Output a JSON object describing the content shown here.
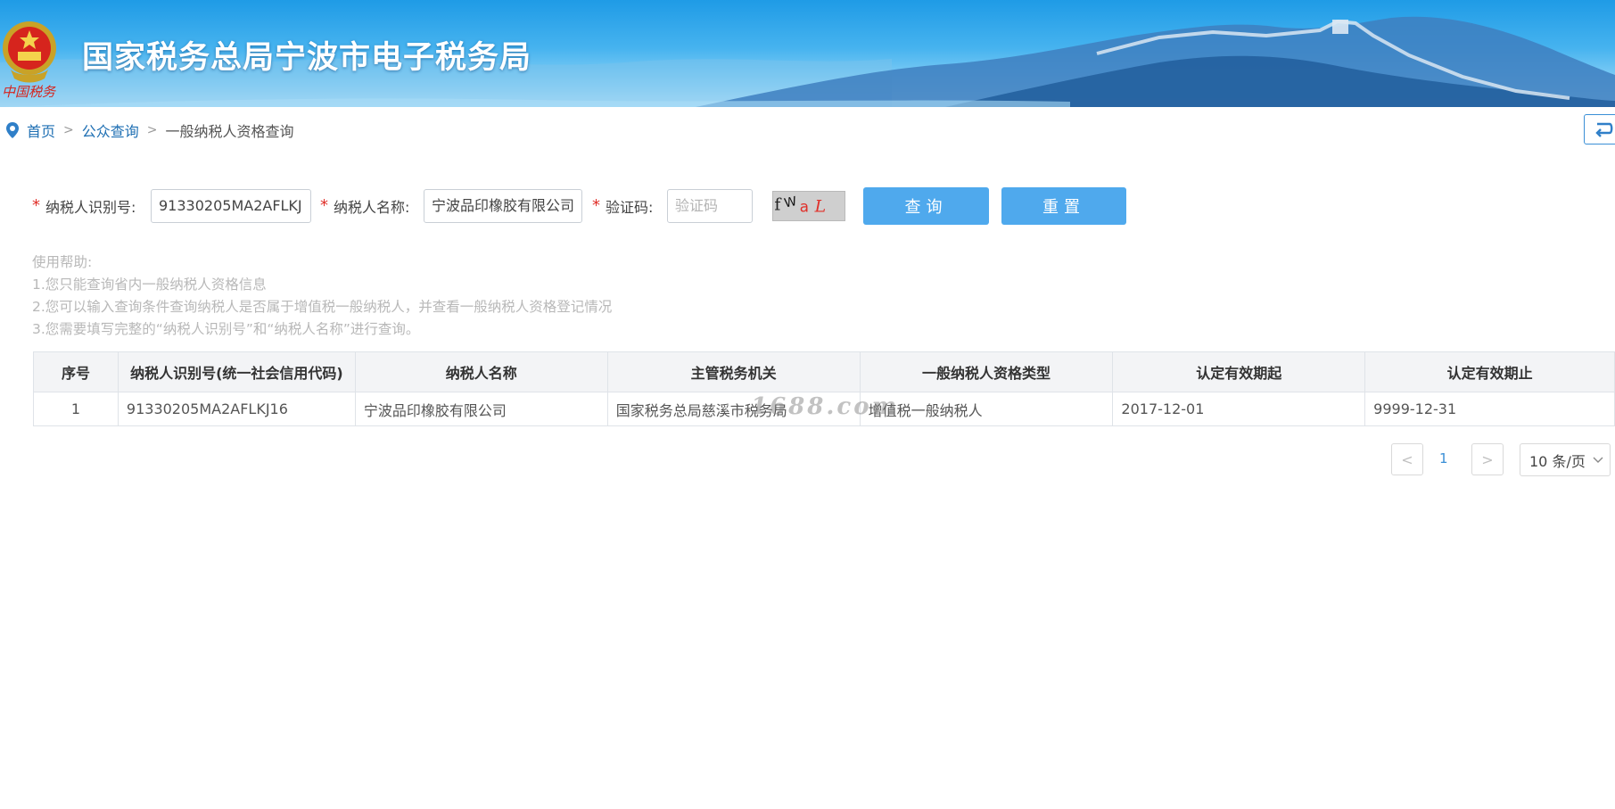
{
  "header": {
    "site_title": "国家税务总局宁波市电子税务局",
    "emblem_caption": "中国税务"
  },
  "breadcrumb": {
    "items": [
      "首页",
      "公众查询",
      "一般纳税人资格查询"
    ],
    "separator": ">"
  },
  "form": {
    "taxpayer_id_label": "纳税人识别号:",
    "taxpayer_id_value": "91330205MA2AFLKJ",
    "taxpayer_name_label": "纳税人名称:",
    "taxpayer_name_value": "宁波品印橡胶有限公司",
    "captcha_label": "验证码:",
    "captcha_placeholder": "验证码",
    "captcha_text": "fWaL",
    "required_mark": "*",
    "query_button": "查询",
    "reset_button": "重置"
  },
  "help": {
    "title": "使用帮助:",
    "lines": [
      "1.您只能查询省内一般纳税人资格信息",
      "2.您可以输入查询条件查询纳税人是否属于增值税一般纳税人，并查看一般纳税人资格登记情况",
      "3.您需要填写完整的“纳税人识别号”和“纳税人名称”进行查询。"
    ]
  },
  "table": {
    "columns": [
      "序号",
      "纳税人识别号(统一社会信用代码)",
      "纳税人名称",
      "主管税务机关",
      "一般纳税人资格类型",
      "认定有效期起",
      "认定有效期止"
    ],
    "rows": [
      [
        "1",
        "91330205MA2AFLKJ16",
        "宁波品印橡胶有限公司",
        "国家税务总局慈溪市税务局",
        "增值税一般纳税人",
        "2017-12-01",
        "9999-12-31"
      ]
    ]
  },
  "watermark": "1688.com",
  "pagination": {
    "prev": "<",
    "current_page": "1",
    "next": ">",
    "page_size": "10 条/页"
  },
  "colors": {
    "accent": "#4fa9ed",
    "link": "#1e6fb3",
    "required": "#e0302a",
    "banner_top": "#1f9be6"
  }
}
